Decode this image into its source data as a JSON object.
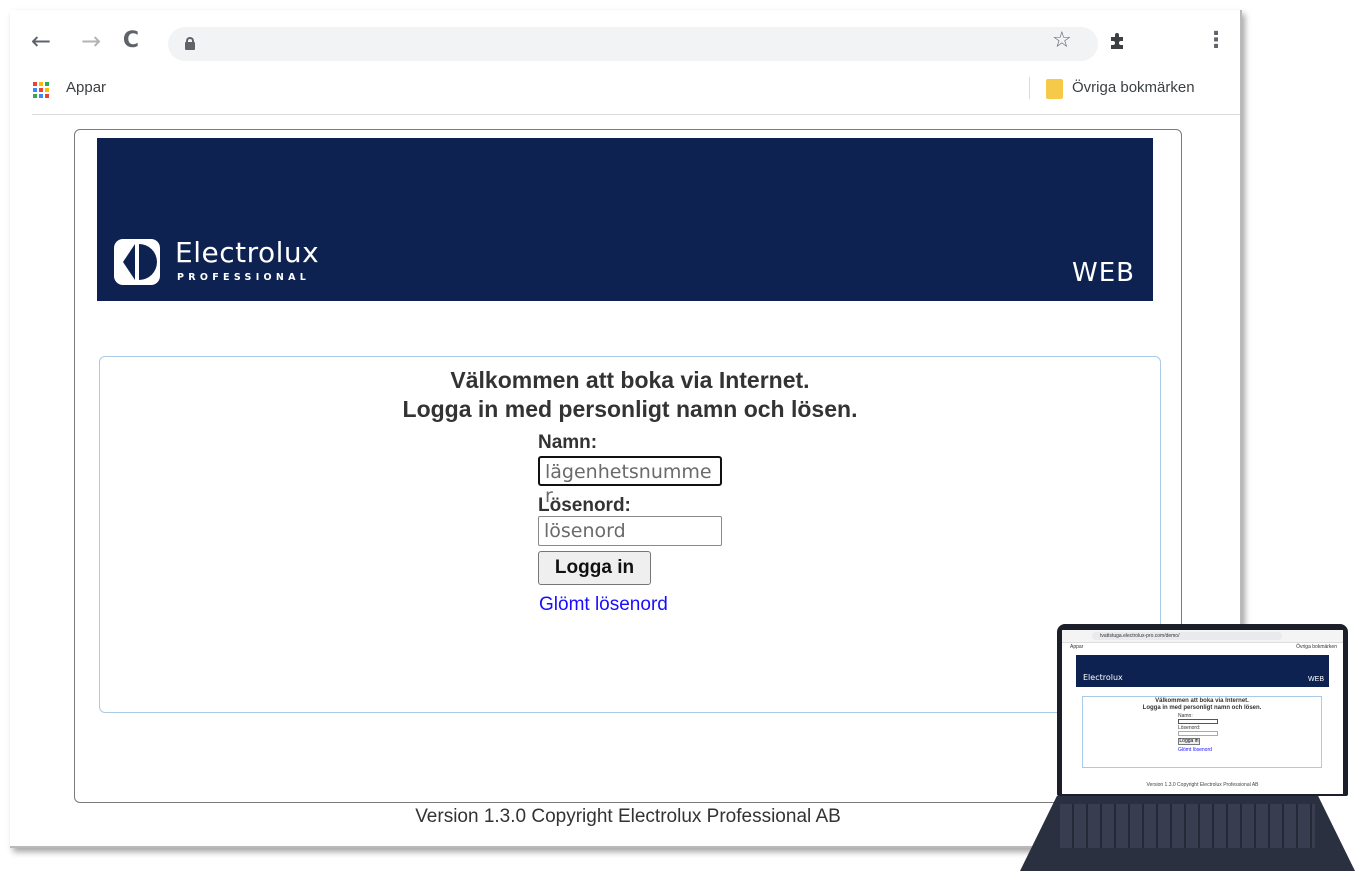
{
  "browser": {
    "toolbar": {
      "back_icon": "←",
      "forward_icon": "→",
      "reload_icon": "C",
      "url": "",
      "bookmark_star_icon": "☆",
      "extensions_icon": "puzzle",
      "menu_icon": "⋮"
    },
    "bookmarks_bar": {
      "apps_label": "Appar",
      "other_bookmarks_label": "Övriga bokmärken"
    }
  },
  "banner": {
    "logo_name": "Electrolux",
    "logo_sub": "PROFESSIONAL",
    "product_label": "WEB",
    "background_color": "#0d2251"
  },
  "login": {
    "welcome_line1": "Välkommen att boka via Internet.",
    "welcome_line2": "Logga in med personligt namn och lösen.",
    "name_label": "Namn:",
    "name_placeholder": "lägenhetsnummer",
    "password_label": "Lösenord:",
    "password_placeholder": "lösenord",
    "submit_label": "Logga in",
    "forgot_link": "Glömt lösenord"
  },
  "footer": {
    "text": "Version 1.3.0 Copyright Electrolux Professional AB"
  },
  "laptop_preview": {
    "url": "tvattstuga.electrolux-pro.com/demo/",
    "apps_label": "Appar",
    "other_bookmarks_label": "Övriga bokmärken",
    "logo_name": "Electrolux",
    "product_label": "WEB",
    "welcome_line1": "Välkommen att boka via Internet.",
    "welcome_line2": "Logga in med personligt namn och lösen.",
    "name_label": "Namn:",
    "password_label": "Lösenord:",
    "submit_label": "Logga in",
    "forgot_link": "Glömt lösenord",
    "footer": "Version 1.3.0 Copyright Electrolux Professional AB"
  }
}
